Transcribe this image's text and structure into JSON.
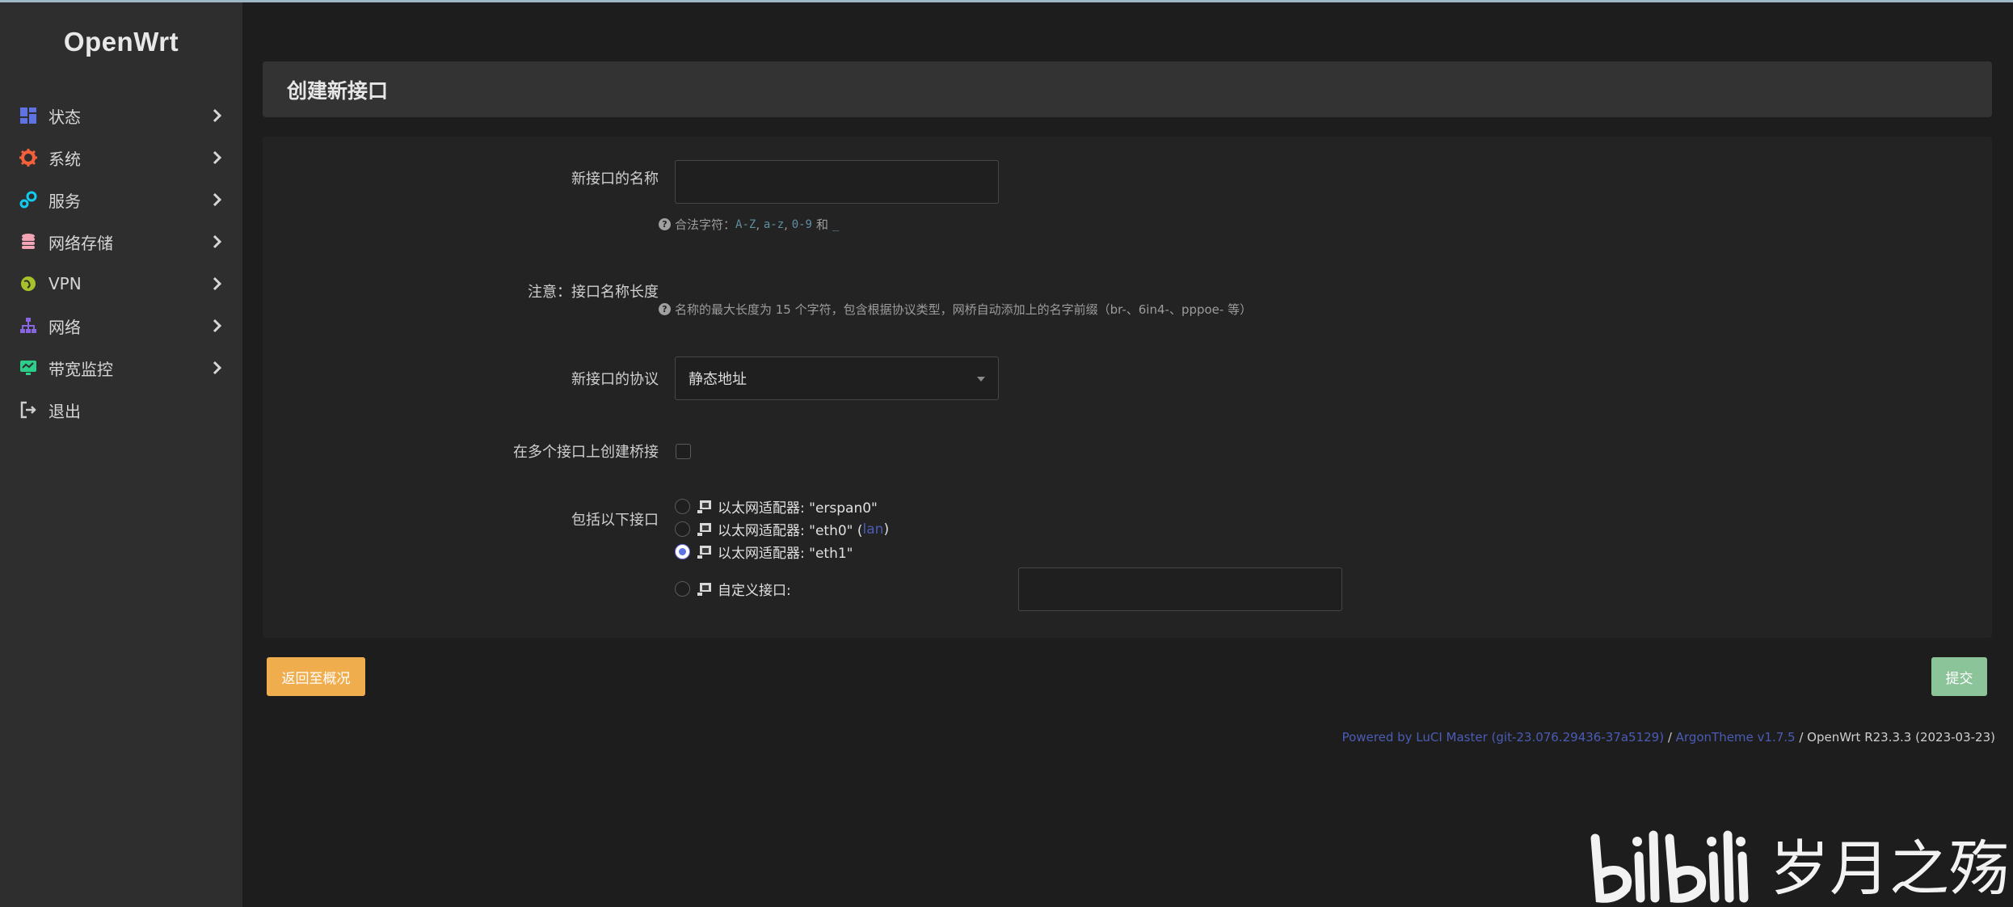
{
  "app": {
    "logo_text": "OpenWrt"
  },
  "sidebar": {
    "items": [
      {
        "label": "状态",
        "icon": "dashboard-icon",
        "color": "#5e72e4",
        "has_arrow": true
      },
      {
        "label": "系统",
        "icon": "gear-icon",
        "color": "#f5603b",
        "has_arrow": true
      },
      {
        "label": "服务",
        "icon": "services-icon",
        "color": "#11cdef",
        "has_arrow": true
      },
      {
        "label": "网络存储",
        "icon": "database-icon",
        "color": "#f3a4b5",
        "has_arrow": true
      },
      {
        "label": "VPN",
        "icon": "vpn-globe-icon",
        "color": "#a6c12a",
        "has_arrow": true
      },
      {
        "label": "网络",
        "icon": "network-tree-icon",
        "color": "#8965e0",
        "has_arrow": true
      },
      {
        "label": "带宽监控",
        "icon": "monitor-icon",
        "color": "#2dce89",
        "has_arrow": true
      },
      {
        "label": "退出",
        "icon": "logout-icon",
        "color": "#cfcfcf",
        "has_arrow": false
      }
    ]
  },
  "page": {
    "title": "创建新接口"
  },
  "form": {
    "name_label": "新接口的名称",
    "name_value": "",
    "name_help_prefix": "合法字符：",
    "name_help_c1": "A-Z",
    "name_help_c2": "a-z",
    "name_help_c3": "0-9",
    "name_help_and": "和",
    "name_help_c4": "_",
    "note_label": "注意：接口名称长度",
    "note_help": "名称的最大长度为 15 个字符，包含根据协议类型，网桥自动添加上的名字前缀（br-、6in4-、pppoe- 等）",
    "protocol_label": "新接口的协议",
    "protocol_value": "静态地址",
    "bridge_label": "在多个接口上创建桥接",
    "bridge_checked": false,
    "include_label": "包括以下接口",
    "interfaces": [
      {
        "label": "以太网适配器: \"erspan0\"",
        "checked": false
      },
      {
        "label": "以太网适配器: \"eth0\" (",
        "link": "lan",
        "suffix": ")",
        "checked": false
      },
      {
        "label": "以太网适配器: \"eth1\"",
        "checked": true
      }
    ],
    "custom_label": "自定义接口:",
    "custom_value": ""
  },
  "buttons": {
    "back": "返回至概况",
    "submit": "提交"
  },
  "footer": {
    "luci": "Powered by LuCI Master (git-23.076.29436-37a5129)",
    "sep1": " / ",
    "theme": "ArgonTheme v1.7.5",
    "sep2": " / ",
    "version": "OpenWrt R23.3.3 (2023-03-23)"
  },
  "watermark": {
    "text": "岁月之殇"
  }
}
